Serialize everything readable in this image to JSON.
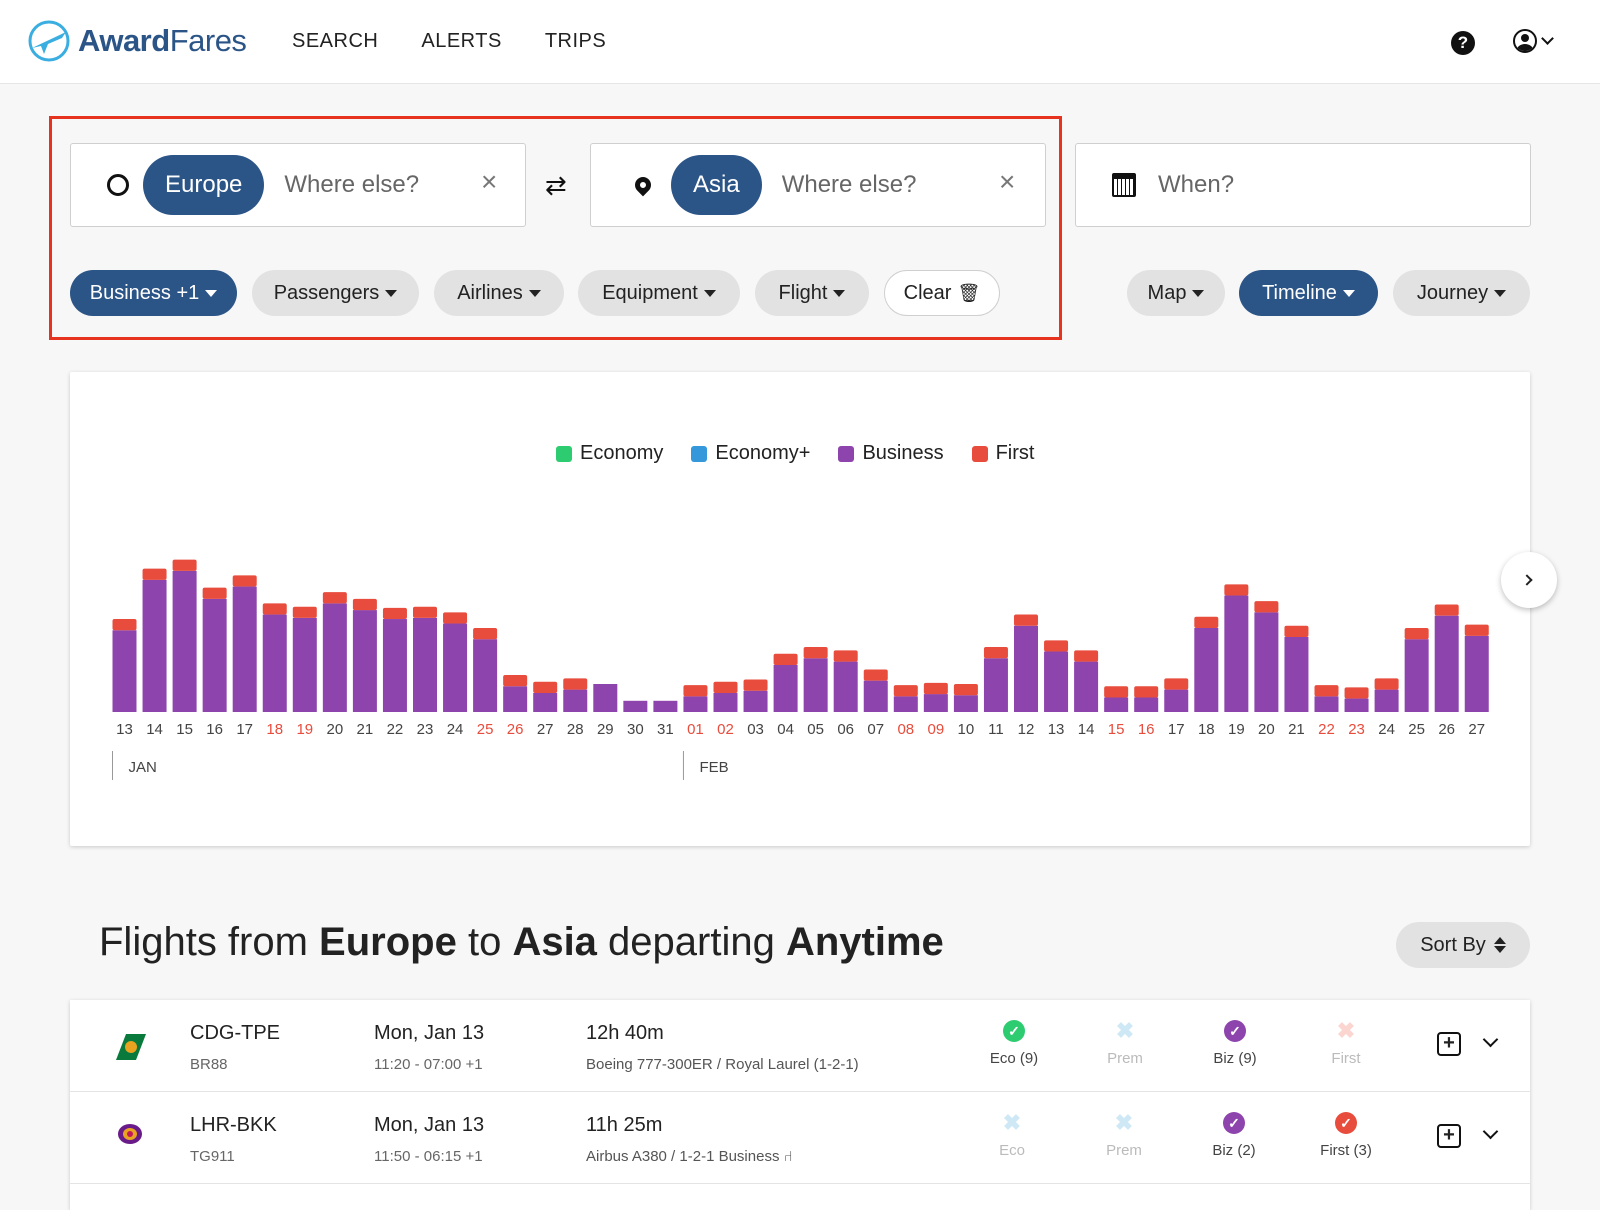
{
  "brand": {
    "name_bold": "Award",
    "name_light": "Fares",
    "accent": "#2b5487",
    "logo_icon": "plane-circle-icon"
  },
  "nav": {
    "search": "SEARCH",
    "alerts": "ALERTS",
    "trips": "TRIPS"
  },
  "header_icons": {
    "help": "?",
    "user": "user-circle-icon"
  },
  "search": {
    "origin_chip": "Europe",
    "origin_placeholder": "Where else?",
    "destination_chip": "Asia",
    "destination_placeholder": "Where else?",
    "when_placeholder": "When?"
  },
  "filters": {
    "cabin": "Business +1",
    "passengers": "Passengers",
    "airlines": "Airlines",
    "equipment": "Equipment",
    "flight": "Flight",
    "clear": "Clear"
  },
  "views": {
    "map": "Map",
    "timeline": "Timeline",
    "journey": "Journey"
  },
  "chart_data": {
    "type": "bar",
    "stacked": true,
    "legend": [
      {
        "name": "Economy",
        "color": "#2ecc71"
      },
      {
        "name": "Economy+",
        "color": "#3498db"
      },
      {
        "name": "Business",
        "color": "#8e44ad"
      },
      {
        "name": "First",
        "color": "#e74c3c"
      }
    ],
    "categories": [
      "13",
      "14",
      "15",
      "16",
      "17",
      "18",
      "19",
      "20",
      "21",
      "22",
      "23",
      "24",
      "25",
      "26",
      "27",
      "28",
      "29",
      "30",
      "31",
      "01",
      "02",
      "03",
      "04",
      "05",
      "06",
      "07",
      "08",
      "09",
      "10",
      "11",
      "12",
      "13",
      "14",
      "15",
      "16",
      "17",
      "18",
      "19",
      "20",
      "21",
      "22",
      "23",
      "24",
      "25",
      "26",
      "27"
    ],
    "weekend": [
      false,
      false,
      false,
      false,
      false,
      true,
      true,
      false,
      false,
      false,
      false,
      false,
      true,
      true,
      false,
      false,
      false,
      false,
      false,
      true,
      true,
      false,
      false,
      false,
      false,
      false,
      true,
      true,
      false,
      false,
      false,
      false,
      false,
      true,
      true,
      false,
      false,
      false,
      false,
      false,
      true,
      true,
      false,
      false,
      false,
      false
    ],
    "months": [
      {
        "label": "JAN",
        "start_index": 0
      },
      {
        "label": "FEB",
        "start_index": 19
      }
    ],
    "series": [
      {
        "name": "Business",
        "values": [
          73,
          118,
          126,
          101,
          112,
          87,
          84,
          97,
          91,
          83,
          84,
          79,
          65,
          23,
          17,
          20,
          25,
          10,
          10,
          14,
          17,
          19,
          42,
          48,
          45,
          28,
          14,
          16,
          15,
          48,
          77,
          54,
          45,
          13,
          13,
          20,
          75,
          104,
          89,
          67,
          14,
          12,
          20,
          65,
          86,
          68
        ]
      },
      {
        "name": "First",
        "values": [
          10,
          10,
          10,
          10,
          10,
          10,
          10,
          10,
          10,
          10,
          10,
          10,
          10,
          10,
          10,
          10,
          0,
          0,
          0,
          10,
          10,
          10,
          10,
          10,
          10,
          10,
          10,
          10,
          10,
          10,
          10,
          10,
          10,
          10,
          10,
          10,
          10,
          10,
          10,
          10,
          10,
          10,
          10,
          10,
          10,
          10
        ]
      }
    ]
  },
  "results": {
    "heading": {
      "prefix": "Flights from ",
      "origin": "Europe",
      "mid": " to ",
      "destination": "Asia",
      "mid2": " departing ",
      "when": "Anytime"
    },
    "sort_label": "Sort By",
    "rows": [
      {
        "route": "CDG-TPE",
        "flight": "BR88",
        "date": "Mon, Jan 13",
        "times": "11:20 - 07:00 +1",
        "duration": "12h 40m",
        "equipment": "Boeing 777-300ER / Royal Laurel (1-2-1)",
        "eco": "Eco (9)",
        "prem": "Prem",
        "biz": "Biz (9)",
        "first": "First",
        "eco_color": "#2ecc71",
        "biz_color": "#8e44ad"
      },
      {
        "route": "LHR-BKK",
        "flight": "TG911",
        "date": "Mon, Jan 13",
        "times": "11:50 - 06:15 +1",
        "duration": "11h 25m",
        "equipment": "Airbus A380 / 1-2-1 Business",
        "eco": "Eco",
        "prem": "Prem",
        "biz": "Biz (2)",
        "first": "First (3)",
        "biz_color": "#8e44ad",
        "first_color": "#e74c3c"
      }
    ]
  }
}
